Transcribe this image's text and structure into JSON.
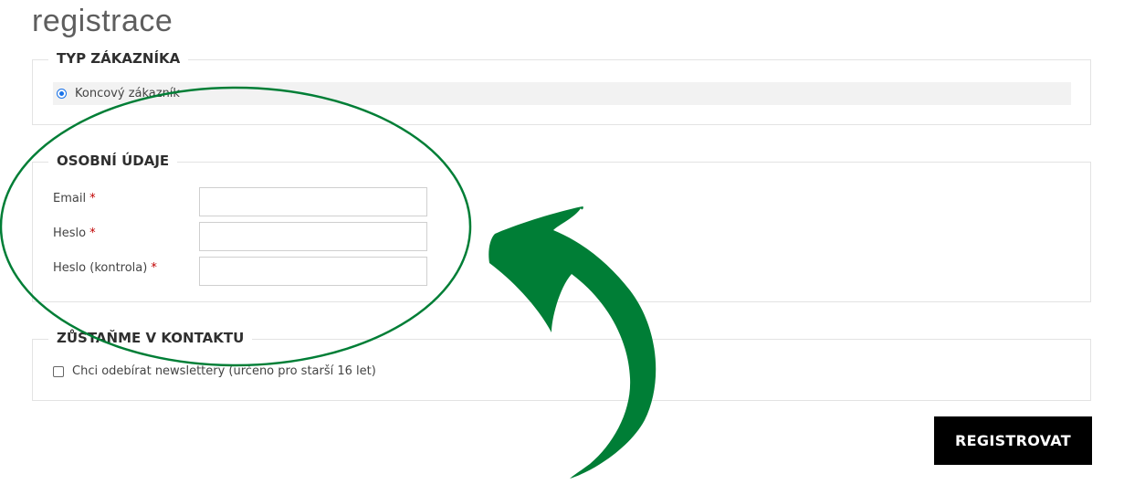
{
  "page": {
    "title": "registrace"
  },
  "customer_type": {
    "legend": "TYP ZÁKAZNÍKA",
    "option_label": "Koncový zákazník",
    "selected": true
  },
  "personal": {
    "legend": "OSOBNÍ ÚDAJE",
    "fields": [
      {
        "label": "Email",
        "required_mark": "*",
        "value": ""
      },
      {
        "label": "Heslo",
        "required_mark": "*",
        "value": ""
      },
      {
        "label": "Heslo (kontrola)",
        "required_mark": "*",
        "value": ""
      }
    ]
  },
  "contact": {
    "legend": "ZŮSTAŇME V KONTAKTU",
    "newsletter_label": "Chci odebírat newslettery (určeno pro starší 16 let)",
    "checked": false
  },
  "actions": {
    "submit_label": "REGISTROVAT"
  },
  "annotation": {
    "color": "#007e36",
    "shapes": [
      "ellipse-highlight",
      "curved-arrow"
    ]
  }
}
